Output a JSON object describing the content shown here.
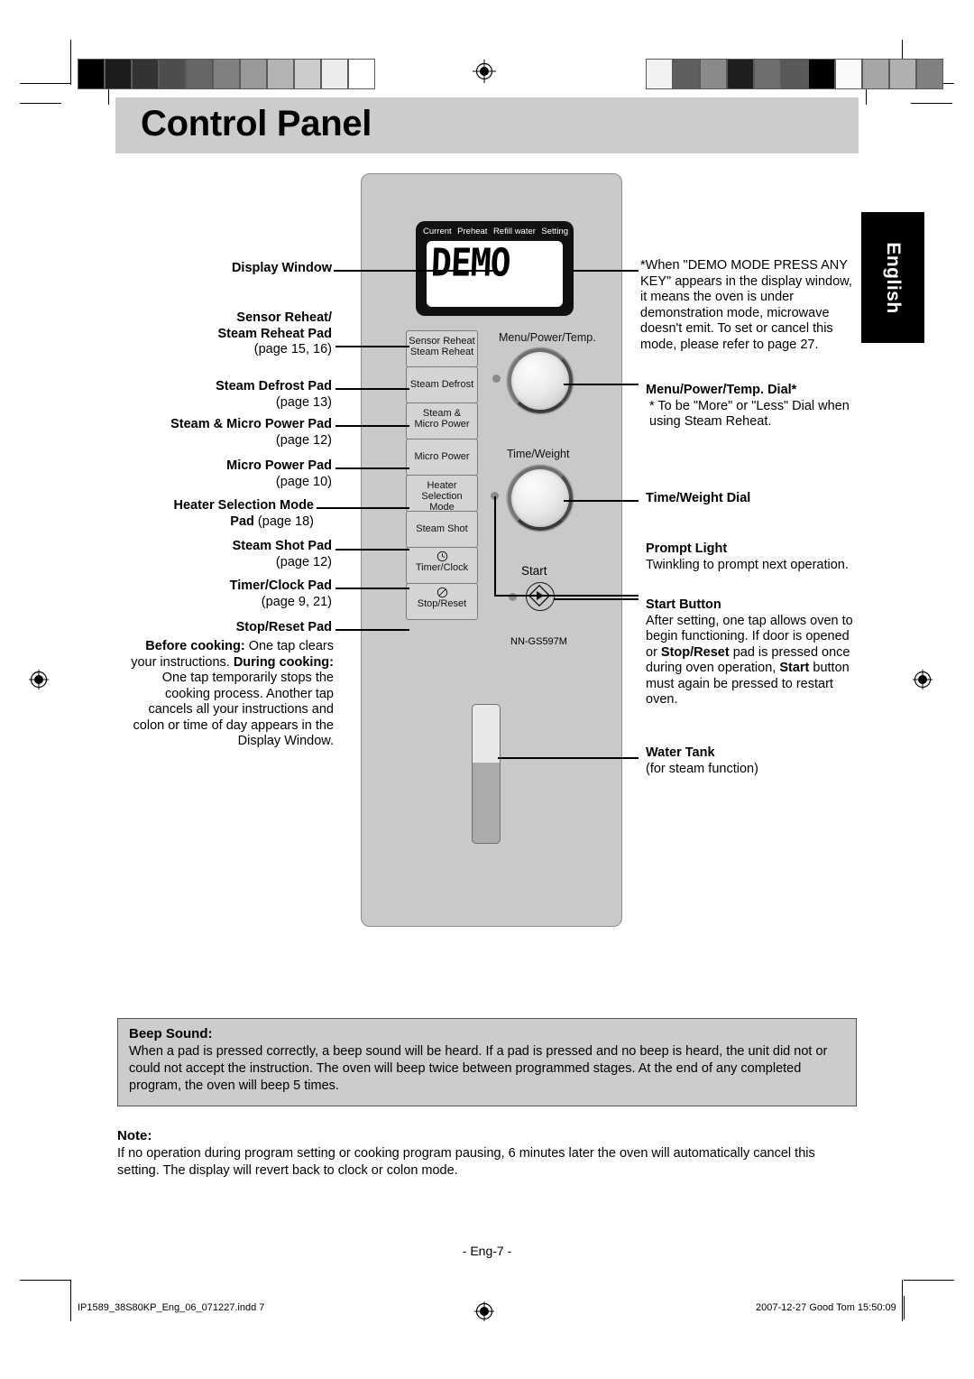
{
  "page": {
    "title": "Control Panel",
    "language_tab": "English",
    "page_number": "- Eng-7 -",
    "footer_left": "IP1589_38S80KP_Eng_06_071227.indd   7",
    "footer_right": "2007-12-27   Good Tom 15:50:09"
  },
  "panel": {
    "model_number": "NN-GS597M",
    "display": {
      "indicators": [
        "Current",
        "Preheat",
        "Refill water",
        "Setting"
      ],
      "lcd_text": "DEMO"
    },
    "pads": [
      {
        "line1": "Sensor Reheat",
        "line2": "Steam Reheat"
      },
      {
        "line1": "Steam Defrost",
        "line2": ""
      },
      {
        "line1": "Steam &",
        "line2": "Micro Power"
      },
      {
        "line1": "Micro Power",
        "line2": ""
      },
      {
        "line1": "Heater",
        "line2": "Selection Mode"
      },
      {
        "line1": "Steam Shot",
        "line2": ""
      },
      {
        "line1": "Timer/Clock",
        "line2": "",
        "icon": "clock-icon"
      },
      {
        "line1": "Stop/Reset",
        "line2": "",
        "icon": "stop-circle-icon"
      }
    ],
    "dials": [
      {
        "label": "Menu/Power/Temp."
      },
      {
        "label": "Time/Weight"
      }
    ],
    "start": {
      "label": "Start",
      "icon": "start-diamond-icon"
    }
  },
  "left_callouts": [
    {
      "title": "Display Window",
      "page_ref": ""
    },
    {
      "title": "Sensor Reheat/\nSteam Reheat Pad",
      "title_line1": "Sensor Reheat/",
      "title_line2": "Steam Reheat Pad",
      "page_ref": "(page 15, 16)"
    },
    {
      "title": "Steam Defrost Pad",
      "page_ref": "(page 13)"
    },
    {
      "title": "Steam & Micro Power Pad",
      "page_ref": "(page 12)"
    },
    {
      "title": "Micro Power Pad",
      "page_ref": "(page 10)"
    },
    {
      "title_line1": "Heater Selection Mode",
      "title_line2": "Pad",
      "page_ref": "(page 18)"
    },
    {
      "title": "Steam Shot Pad",
      "page_ref": "(page 12)"
    },
    {
      "title": "Timer/Clock Pad",
      "page_ref": "(page 9, 21)"
    },
    {
      "title": "Stop/Reset Pad",
      "page_ref": ""
    }
  ],
  "left_body": {
    "before_label": "Before cooking:",
    "before_text": " One tap clears your instructions.",
    "during_label": "During cooking:",
    "during_text": " One tap temporarily stops the cooking process. Another tap cancels all your instructions and  colon or time of day appears in the Display Window."
  },
  "right_callouts": {
    "demo_note": "*When \"DEMO MODE PRESS ANY KEY\" appears in the display window, it means the oven is under demonstration mode, microwave doesn't emit. To set or cancel this mode, please refer to page 27.",
    "menu_dial_title": "Menu/Power/Temp. Dial*",
    "menu_dial_note": "* To be \"More\" or \"Less\" Dial when using Steam Reheat.",
    "time_dial_title": "Time/Weight Dial",
    "prompt_light_title": "Prompt Light",
    "prompt_light_note": "Twinkling to prompt next operation.",
    "start_title": "Start Button",
    "start_note_1": "After setting, one tap allows oven to begin functioning. If door is opened or ",
    "start_note_bold_1": "Stop/Reset",
    "start_note_2": " pad is pressed once during oven operation, ",
    "start_note_bold_2": "Start",
    "start_note_3": " button must again be pressed to restart oven.",
    "water_tank_title": "Water Tank",
    "water_tank_note": "(for steam function)"
  },
  "beep": {
    "heading": "Beep Sound:",
    "body": "When a pad is pressed correctly, a beep sound will be heard. If a pad is pressed and no beep is heard, the unit did not or could not accept the instruction. The oven will beep twice between programmed stages. At the end of any completed program, the oven will beep 5 times."
  },
  "note": {
    "heading": "Note:",
    "body": "If no operation during program setting or cooking program pausing, 6 minutes later the oven will automatically cancel this setting. The display will revert back to clock or colon mode."
  },
  "wedges": {
    "left_steps": [
      "#000000",
      "#1c1c1c",
      "#333333",
      "#4d4d4d",
      "#666666",
      "#808080",
      "#999999",
      "#b3b3b3",
      "#cccccc",
      "#ececec",
      "#ffffff"
    ],
    "right_steps": [
      "#f2f2f2",
      "#5e5e5e",
      "#8a8a8a",
      "#1f1f1f",
      "#6e6e6e",
      "#595959",
      "#000000",
      "#fafafa",
      "#a6a6a6",
      "#b0b0b0",
      "#808080"
    ]
  }
}
